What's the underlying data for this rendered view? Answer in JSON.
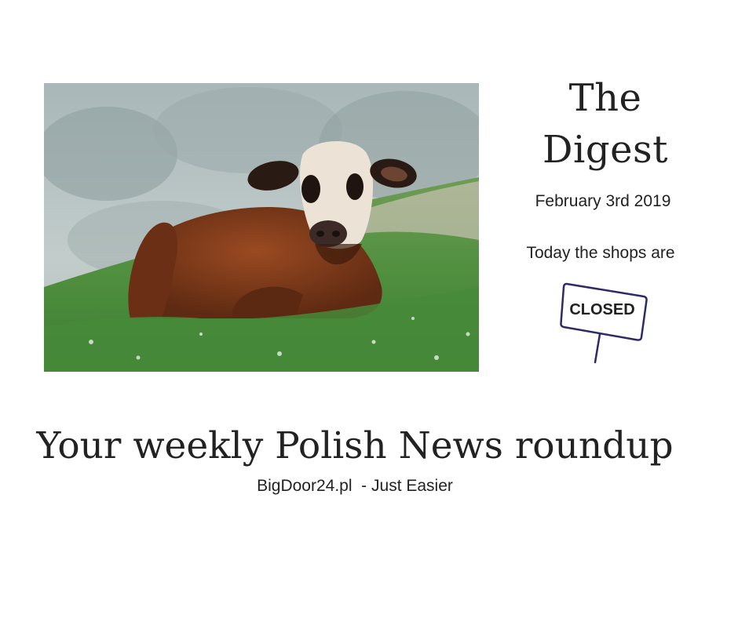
{
  "masthead": {
    "title_line1": "The",
    "title_line2": "Digest",
    "date": "February 3rd 2019"
  },
  "status": {
    "label": "Today the shops are",
    "sign_text": "CLOSED",
    "sign_color": "#2e2a66"
  },
  "footer": {
    "headline": "Your weekly Polish News roundup",
    "tagline": "BigDoor24.pl  - Just Easier"
  },
  "photo": {
    "icon": "calf-photo"
  }
}
